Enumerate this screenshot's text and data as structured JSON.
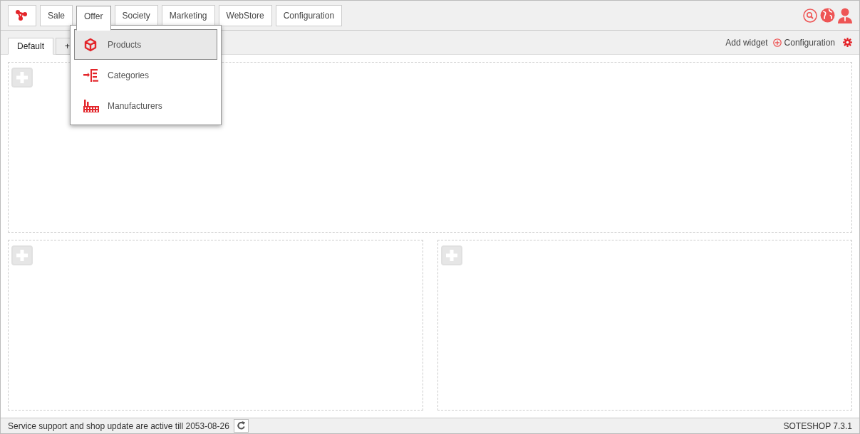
{
  "main_menu": [
    {
      "label": "Sale",
      "selected": false
    },
    {
      "label": "Offer",
      "selected": true,
      "open": true,
      "items": [
        {
          "label": "Products",
          "kind": "box",
          "selected": true
        },
        {
          "label": "Categories",
          "kind": "tree",
          "selected": false
        },
        {
          "label": "Manufacturers",
          "kind": "factory",
          "selected": false
        }
      ]
    },
    {
      "label": "Society",
      "selected": false
    },
    {
      "label": "Marketing",
      "selected": false
    },
    {
      "label": "WebStore",
      "selected": false
    },
    {
      "label": "Configuration",
      "selected": false
    }
  ],
  "dashboard_tabs": [
    {
      "label": "Default",
      "selected": true
    },
    {
      "label": "+",
      "selected": false
    }
  ],
  "toolbar": {
    "add_widget": "Add widget",
    "configuration": "Configuration"
  },
  "widget_zones": [
    {
      "kind": "full"
    },
    {
      "kind": "half"
    },
    {
      "kind": "half"
    }
  ],
  "status_bar": {
    "support": "Service support and shop update are active till 2053-08-26",
    "version": "SOTESHOP 7.3.1"
  }
}
